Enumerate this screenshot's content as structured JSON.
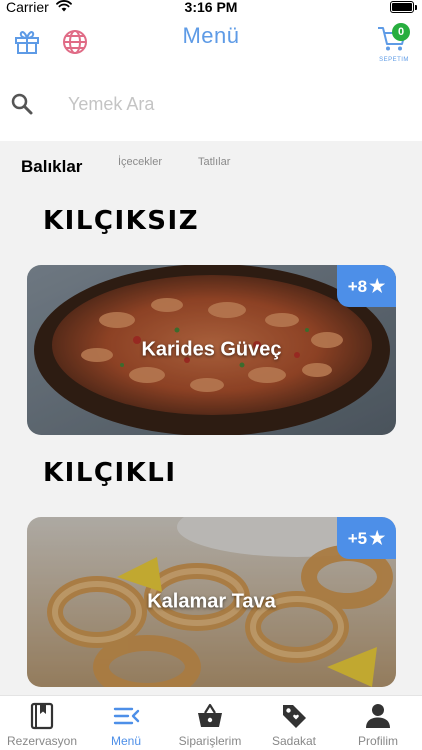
{
  "status_bar": {
    "carrier": "Carrier",
    "time": "3:16 PM"
  },
  "header": {
    "title": "Menü",
    "cart_count": "0",
    "cart_label": "SEPETIM"
  },
  "search": {
    "placeholder": "Yemek Ara",
    "value": ""
  },
  "categories": [
    {
      "label": "Balıklar",
      "active": true
    },
    {
      "label": "İçecekler",
      "active": false
    },
    {
      "label": "Tatlılar",
      "active": false
    }
  ],
  "sections": [
    {
      "title": "KILÇIKSIZ",
      "item": {
        "name": "Karides Güveç",
        "badge": "+8"
      }
    },
    {
      "title": "KILÇIKLI",
      "item": {
        "name": "Kalamar Tava",
        "badge": "+5"
      }
    }
  ],
  "tab_bar": [
    {
      "label": "Rezervasyon",
      "icon": "book-icon"
    },
    {
      "label": "Menü",
      "icon": "menu-icon"
    },
    {
      "label": "Siparişlerim",
      "icon": "basket-icon"
    },
    {
      "label": "Sadakat",
      "icon": "tag-icon"
    },
    {
      "label": "Profilim",
      "icon": "user-icon"
    }
  ],
  "colors": {
    "accent": "#4d8fe8",
    "badge_green": "#27ae3e",
    "globe_pink": "#e06b86"
  }
}
